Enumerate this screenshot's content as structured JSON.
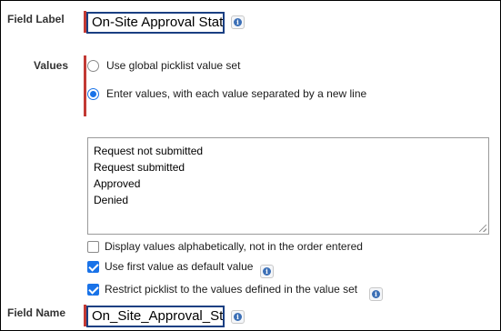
{
  "field_label": {
    "label": "Field Label",
    "value": "On-Site Approval Status"
  },
  "values": {
    "label": "Values",
    "options": [
      {
        "label": "Use global picklist value set",
        "selected": false
      },
      {
        "label": "Enter values, with each value separated by a new line",
        "selected": true
      }
    ],
    "entries": [
      "Request not submitted",
      "Request submitted",
      "Approved",
      "Denied"
    ]
  },
  "checkboxes": [
    {
      "label": "Display values alphabetically, not in the order entered",
      "checked": false
    },
    {
      "label": "Use first value as default value",
      "checked": true
    },
    {
      "label": "Restrict picklist to the values defined in the value set",
      "checked": true
    }
  ],
  "field_name": {
    "label": "Field Name",
    "value": "On_Site_Approval_Status"
  },
  "info_icon": "info-icon",
  "colors": {
    "required_bar": "#c23934",
    "focus_outline": "#1a3f82",
    "accent": "#1a73e8"
  }
}
